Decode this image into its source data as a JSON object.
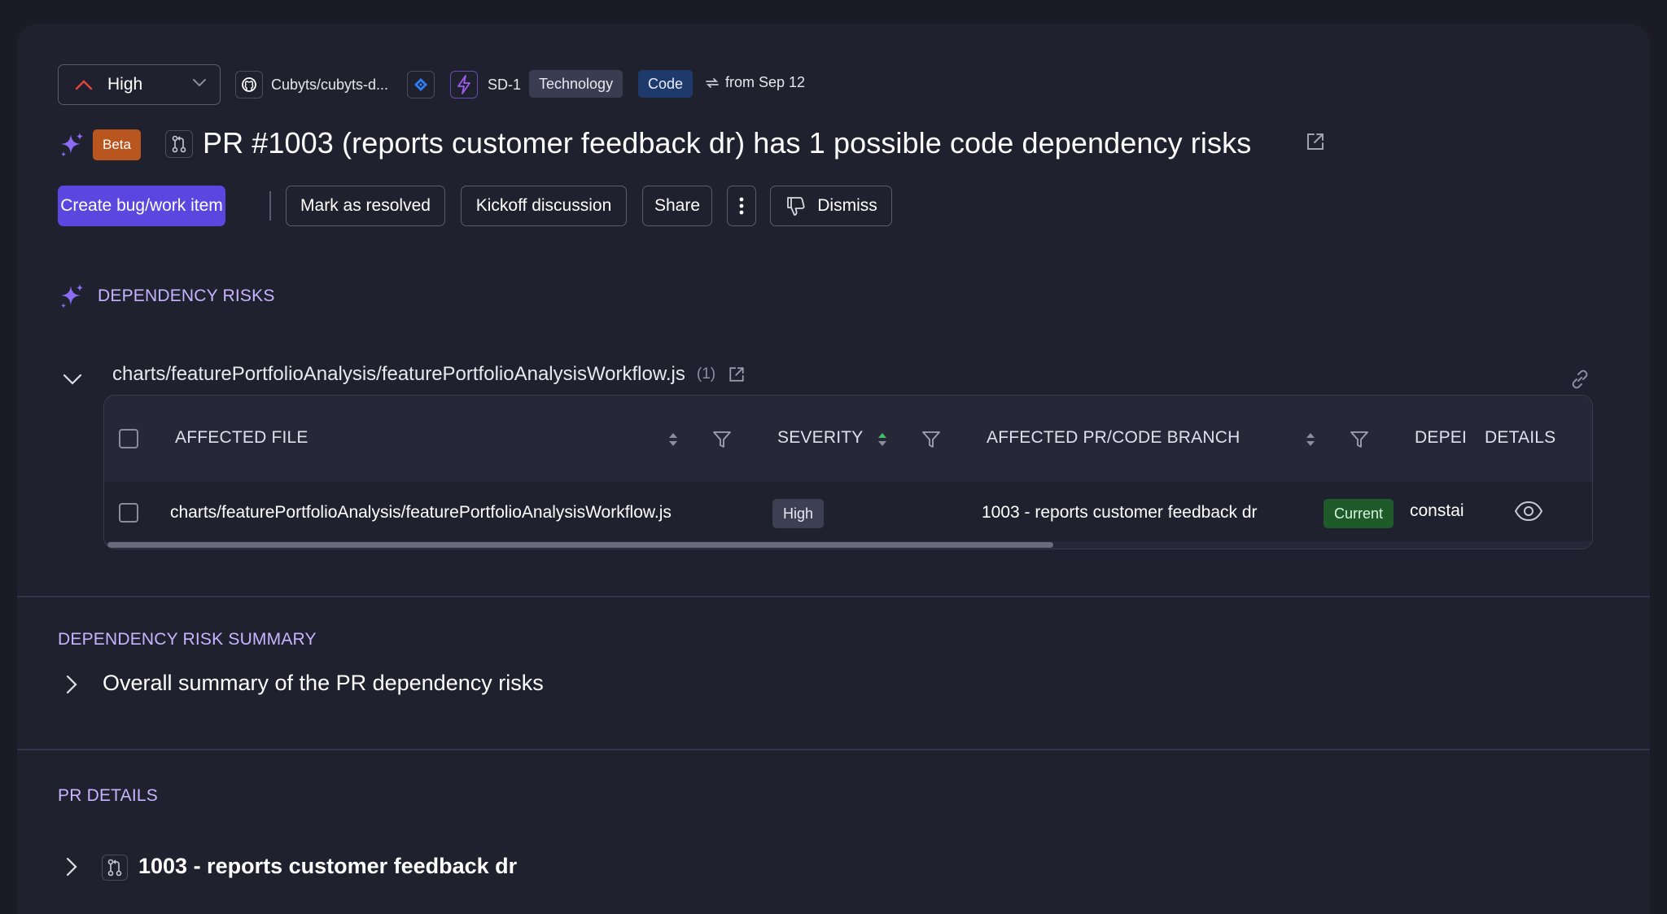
{
  "header": {
    "severity_select": "High",
    "repo": "Cubyts/cubyts-d...",
    "ticket": "SD-1",
    "tags": [
      "Technology",
      "Code"
    ],
    "date_label": "from Sep 12"
  },
  "title_row": {
    "beta_badge": "Beta",
    "title": "PR #1003 (reports customer feedback dr) has 1 possible code dependency risks"
  },
  "actions": {
    "create_bug": "Create bug/work item",
    "mark_resolved": "Mark as resolved",
    "kickoff": "Kickoff discussion",
    "share": "Share",
    "dismiss": "Dismiss"
  },
  "dependency_risks": {
    "section_label": "DEPENDENCY RISKS",
    "file_group": {
      "path": "charts/featurePortfolioAnalysis/featurePortfolioAnalysisWorkflow.js",
      "count": "(1)"
    },
    "table": {
      "columns": [
        "AFFECTED FILE",
        "SEVERITY",
        "AFFECTED PR/CODE BRANCH",
        "DEPEI",
        "DETAILS"
      ],
      "rows": [
        {
          "file": "charts/featurePortfolioAnalysis/featurePortfolioAnalysisWorkflow.js",
          "severity": "High",
          "branch": "1003 - reports customer feedback dr",
          "branch_status": "Current",
          "dependency": "constai"
        }
      ]
    }
  },
  "summary": {
    "section_label": "DEPENDENCY RISK SUMMARY",
    "item": "Overall summary of the PR dependency risks"
  },
  "pr_details": {
    "section_label": "PR DETAILS",
    "item": "1003 - reports customer feedback dr"
  },
  "colors": {
    "accent": "#5b47e0",
    "section_label": "#c7b4ff",
    "beta": "#b9561f",
    "current": "#1e5a2a"
  }
}
